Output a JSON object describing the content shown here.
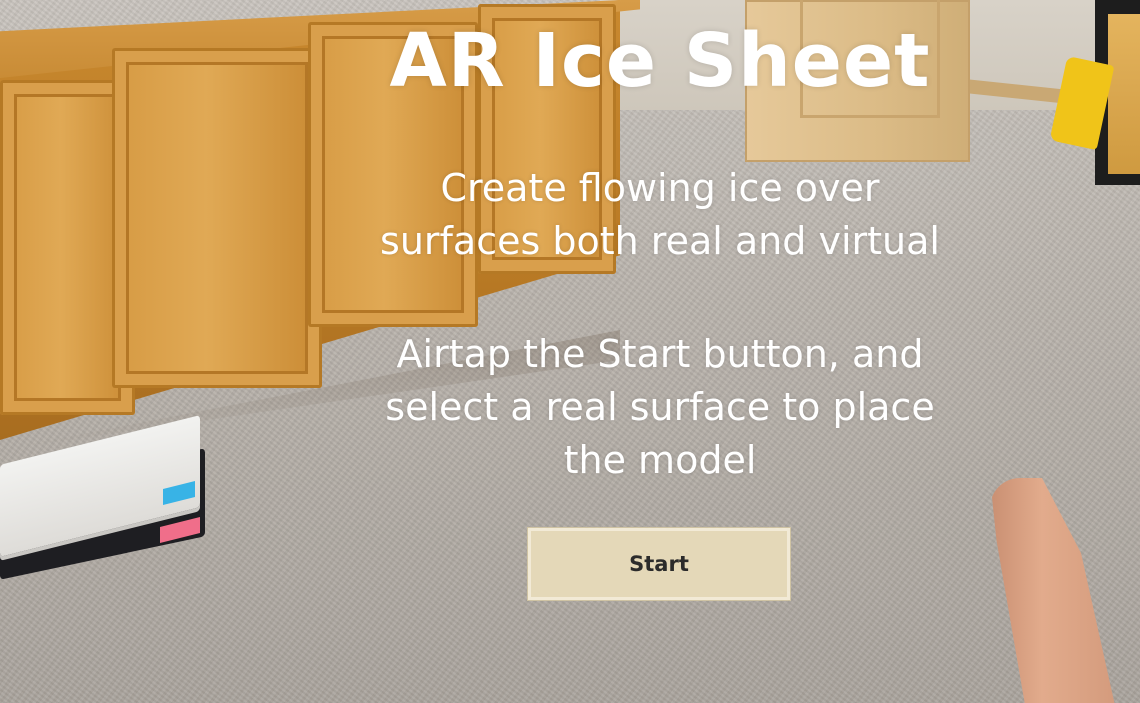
{
  "app": {
    "title": "AR Ice Sheet",
    "subtitle": "Create flowing ice over\nsurfaces both real and virtual",
    "instructions": "Airtap the Start button, and\nselect a real surface to place\nthe model"
  },
  "start_button": {
    "label": "Start"
  },
  "colors": {
    "text": "#ffffff",
    "button_background": "#e4d8b8",
    "button_text": "#2b2b2b"
  }
}
